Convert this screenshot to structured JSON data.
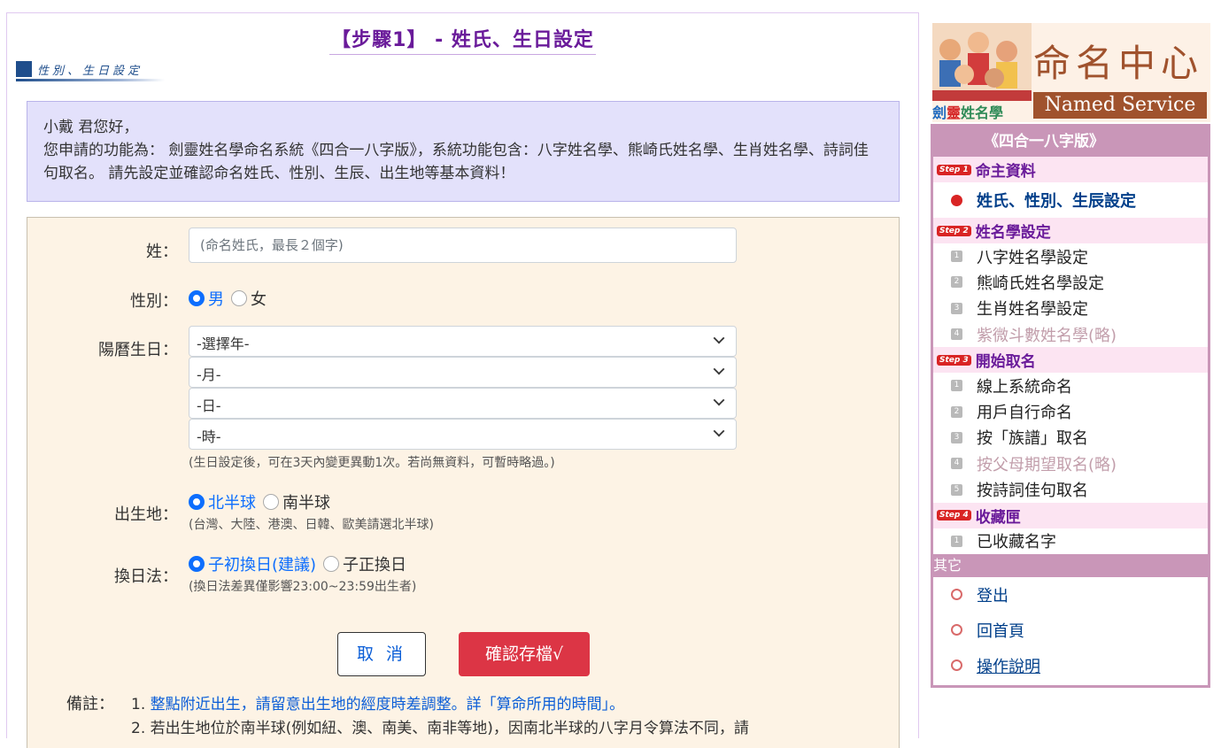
{
  "page_title": "【步驟1】 - 姓氏、生日設定",
  "sub_banner": "性別、生日設定",
  "greeting": {
    "line1": "小戴 君您好，",
    "line2": "您申請的功能為： 劍靈姓名學命名系統《四合一八字版》，系統功能包含：八字姓名學、熊崎氏姓名學、生肖姓名學、詩詞佳句取名。 請先設定並確認命名姓氏、性別、生辰、出生地等基本資料！"
  },
  "form": {
    "surname_label": "姓：",
    "surname_placeholder": "(命名姓氏，最長２個字)",
    "gender_label": "性別：",
    "gender_options": [
      "男",
      "女"
    ],
    "gender_selected": "男",
    "birthday_label": "陽曆生日：",
    "year_select": "-選擇年-",
    "month_select": "-月-",
    "day_select": "-日-",
    "hour_select": "-時-",
    "birthday_hint": "(生日設定後，可在3天內變更異動1次。若尚無資料，可暫時略過。)",
    "birthplace_label": "出生地：",
    "birthplace_options": [
      "北半球",
      "南半球"
    ],
    "birthplace_selected": "北半球",
    "birthplace_hint": "(台灣、大陸、港澳、日韓、歐美請選北半球)",
    "dayswitch_label": "換日法：",
    "dayswitch_options": [
      "子初換日(建議)",
      "子正換日"
    ],
    "dayswitch_selected": "子初換日(建議)",
    "dayswitch_hint": "(換日法差異僅影響23:00~23:59出生者)",
    "cancel_label": "取 消",
    "save_label": "確認存檔√",
    "note_label": "備註：",
    "note1_prefix": "1. ",
    "note1_link": "整點附近出生，請留意出生地的經度時差調整。詳「算命所用的時間」。",
    "note2": "2. 若出生地位於南半球(例如紐、澳、南美、南非等地)，因南北半球的八字月令算法不同，請"
  },
  "logo": {
    "big": "命名中心",
    "en": "Named Service",
    "tag": [
      "劍",
      "靈",
      "姓名學"
    ]
  },
  "sidebar": {
    "header": "《四合一八字版》",
    "steps": [
      {
        "badge": "Step 1",
        "title": "命主資料",
        "items": [
          {
            "label": "姓氏、性別、生辰設定",
            "state": "current"
          }
        ]
      },
      {
        "badge": "Step 2",
        "title": "姓名學設定",
        "items": [
          {
            "num": "1",
            "label": "八字姓名學設定"
          },
          {
            "num": "2",
            "label": "熊崎氏姓名學設定"
          },
          {
            "num": "3",
            "label": "生肖姓名學設定"
          },
          {
            "num": "4",
            "label": "紫微斗數姓名學(略)",
            "state": "disabled"
          }
        ]
      },
      {
        "badge": "Step 3",
        "title": "開始取名",
        "items": [
          {
            "num": "1",
            "label": "線上系統命名"
          },
          {
            "num": "2",
            "label": "用戶自行命名"
          },
          {
            "num": "3",
            "label": "按「族譜」取名"
          },
          {
            "num": "4",
            "label": "按父母期望取名(略)",
            "state": "disabled"
          },
          {
            "num": "5",
            "label": "按詩詞佳句取名"
          }
        ]
      },
      {
        "badge": "Step 4",
        "title": "收藏匣",
        "items": [
          {
            "num": "1",
            "label": "已收藏名字"
          }
        ]
      }
    ],
    "other_header": "其它",
    "other_items": [
      "登出",
      "回首頁",
      "操作說明"
    ]
  }
}
